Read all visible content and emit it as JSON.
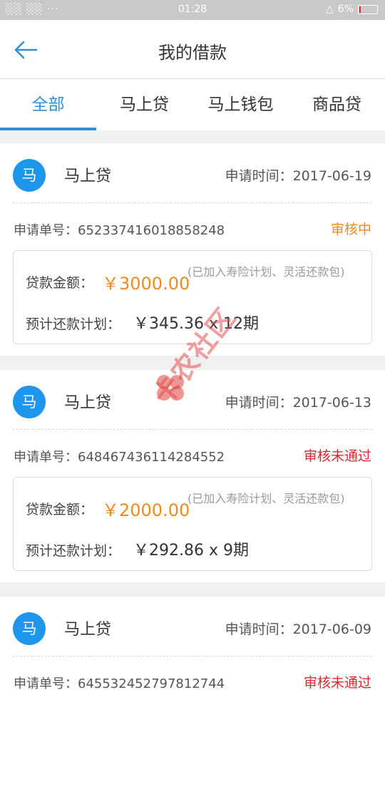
{
  "status_bar": {
    "left": "░░ ░░ ···",
    "time": "01:28",
    "battery": "6%",
    "battery_level": 0.06
  },
  "header": {
    "title": "我的借款"
  },
  "tabs": [
    {
      "label": "全部",
      "active": true
    },
    {
      "label": "马上贷",
      "active": false
    },
    {
      "label": "马上钱包",
      "active": false
    },
    {
      "label": "商品贷",
      "active": false
    }
  ],
  "loans": [
    {
      "avatar": "马",
      "product": "马上贷",
      "apply_time": "申请时间：2017-06-19",
      "order_label": "申请单号：",
      "order_no": "652337416018858248",
      "status": "审核中",
      "status_type": "pending",
      "amount_label": "贷款金额：",
      "amount": "￥3000.00",
      "amount_note": "(已加入寿险计划、灵活还款包)",
      "plan_label": "预计还款计划：",
      "plan": "￥345.36 x 12期"
    },
    {
      "avatar": "马",
      "product": "马上贷",
      "apply_time": "申请时间：2017-06-13",
      "order_label": "申请单号：",
      "order_no": "648467436114284552",
      "status": "审核未通过",
      "status_type": "rejected",
      "amount_label": "贷款金额：",
      "amount": "￥2000.00",
      "amount_note": "(已加入寿险计划、灵活还款包)",
      "plan_label": "预计还款计划：",
      "plan": "￥292.86 x 9期"
    },
    {
      "avatar": "马",
      "product": "马上贷",
      "apply_time": "申请时间：2017-06-09",
      "order_label": "申请单号：",
      "order_no": "645532452797812744",
      "status": "审核未通过",
      "status_type": "rejected",
      "amount_label": "",
      "amount": "",
      "amount_note": "",
      "plan_label": "",
      "plan": ""
    }
  ],
  "watermark": "卡农社区",
  "colors": {
    "accent": "#2f8fd8",
    "avatar": "#1e96ec",
    "pending": "#f08a1c",
    "rejected": "#e0242c"
  }
}
